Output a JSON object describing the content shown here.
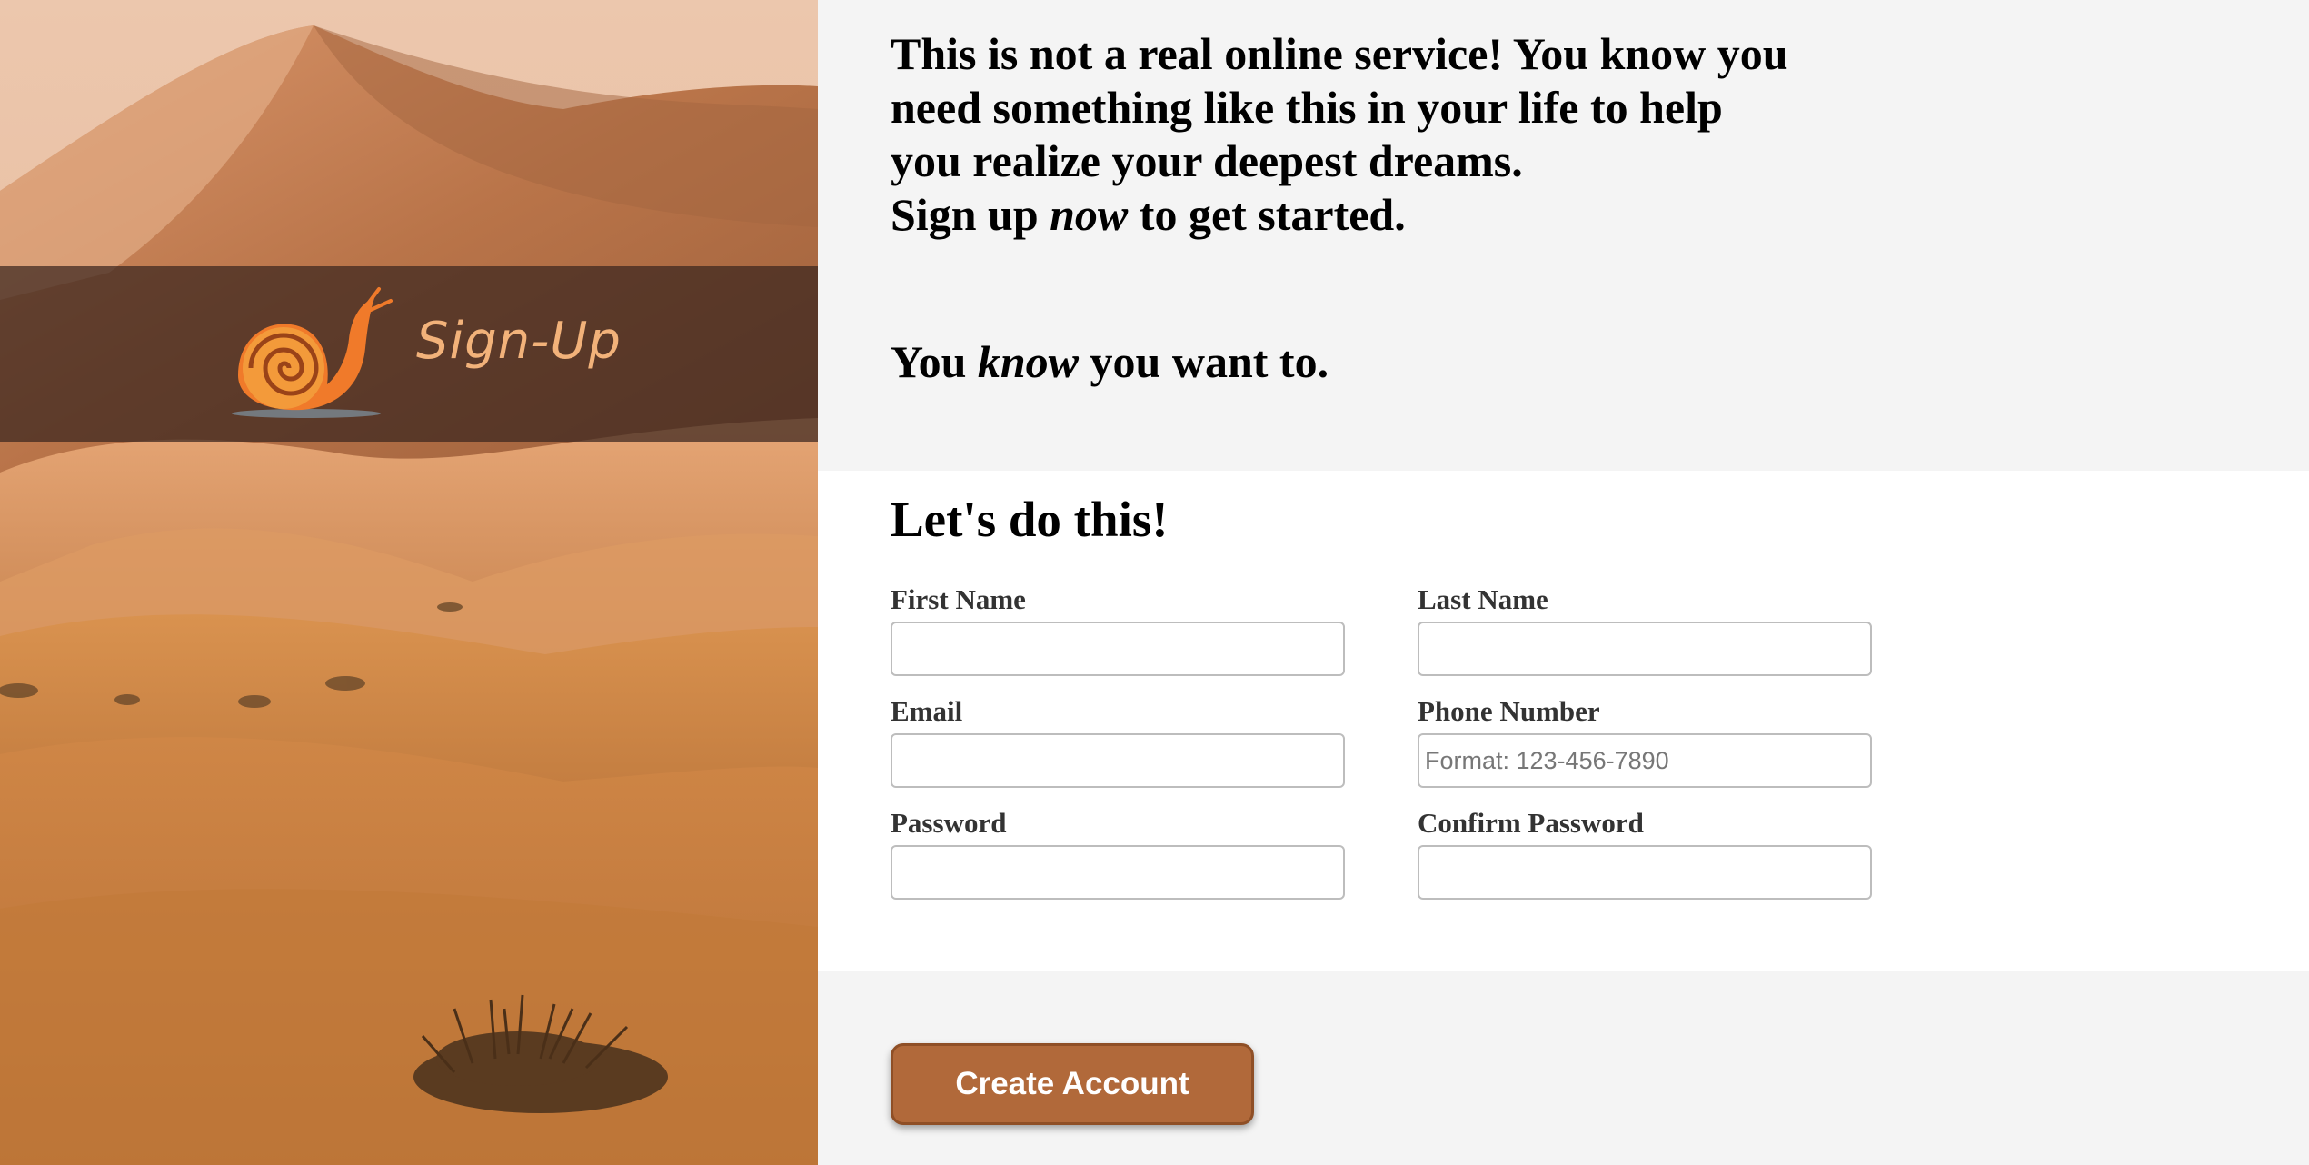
{
  "hero": {
    "logo_text": "Sign-Up",
    "logo_icon": "snail-icon",
    "colors": {
      "band": "#3a261e",
      "logo_orange": "#f28a2e",
      "logo_text": "#f2b27a"
    }
  },
  "intro": {
    "line1_text": "This is not a real online service! You know you need something like this in your life to help you realize your deepest dreams.",
    "line2_before": "Sign up ",
    "line2_em": "now",
    "line2_after": " to get started.",
    "second_before": "You ",
    "second_em": "know",
    "second_after": " you want to."
  },
  "form": {
    "title": "Let's do this!",
    "first_name": {
      "label": "First Name",
      "value": "",
      "placeholder": ""
    },
    "last_name": {
      "label": "Last Name",
      "value": "",
      "placeholder": ""
    },
    "email": {
      "label": "Email",
      "value": "",
      "placeholder": ""
    },
    "phone": {
      "label": "Phone Number",
      "value": "",
      "placeholder": "Format: 123-456-7890"
    },
    "password": {
      "label": "Password",
      "value": "",
      "placeholder": ""
    },
    "confirm_password": {
      "label": "Confirm Password",
      "value": "",
      "placeholder": ""
    }
  },
  "cta": {
    "create_label": "Create Account",
    "color": "#b1693a"
  }
}
